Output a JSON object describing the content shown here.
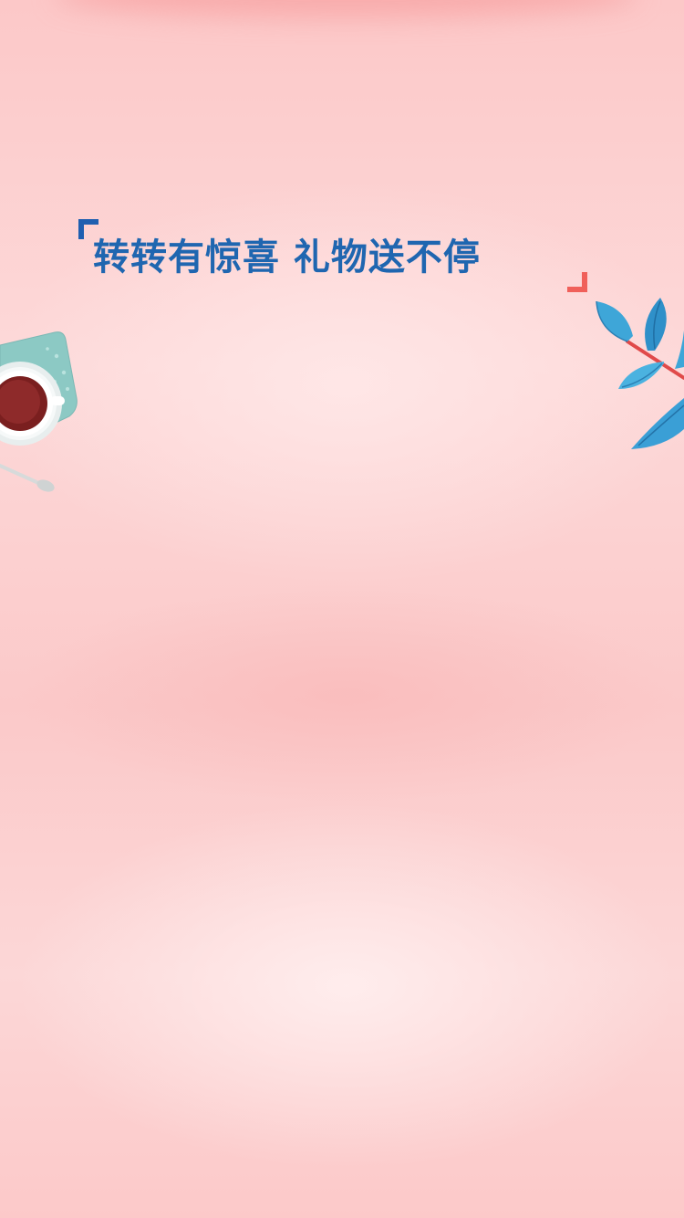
{
  "headline": {
    "text": "转转有惊喜 礼物送不停"
  },
  "icons": {
    "coffee": "coffee-cup-icon",
    "leaves": "leaf-branch-icon"
  },
  "colors": {
    "background": "#fcd0d0",
    "headline_text": "#1f66b0",
    "bracket_left": "#1f5fb0",
    "bracket_right": "#f0605a",
    "leaf": "#3ea6d8"
  }
}
